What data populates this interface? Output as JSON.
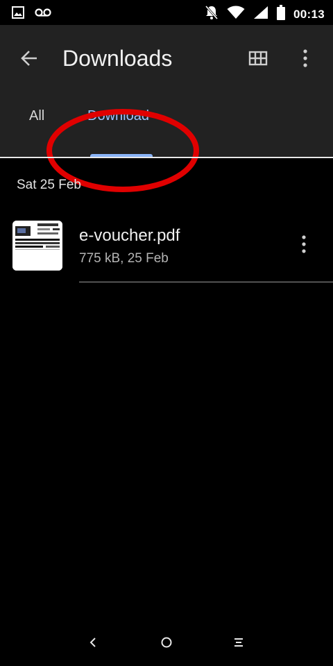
{
  "status_bar": {
    "time": "00:13",
    "left_icons": [
      "image-icon",
      "voicemail-icon"
    ],
    "right_icons": [
      "notifications-off-icon",
      "wifi-icon",
      "signal-icon",
      "battery-icon"
    ]
  },
  "app_bar": {
    "title": "Downloads",
    "back_icon": "arrow-back-icon",
    "grid_icon": "grid-view-icon",
    "more_icon": "more-vertical-icon"
  },
  "tabs": [
    {
      "label": "All",
      "selected": false
    },
    {
      "label": "Download",
      "selected": true
    }
  ],
  "content": {
    "date_header": "Sat 25 Feb",
    "files": [
      {
        "name": "e-voucher.pdf",
        "meta": "775 kB, 25 Feb",
        "thumbnail_icon": "pdf-thumbnail"
      }
    ]
  },
  "nav_bar": {
    "icons": [
      "nav-back-icon",
      "nav-home-icon",
      "nav-recents-icon"
    ]
  },
  "colors": {
    "app_bar_bg": "#222222",
    "selected_tab": "#9cc3ff",
    "tab_indicator": "#8ab4f8",
    "annotation": "#e00000"
  }
}
